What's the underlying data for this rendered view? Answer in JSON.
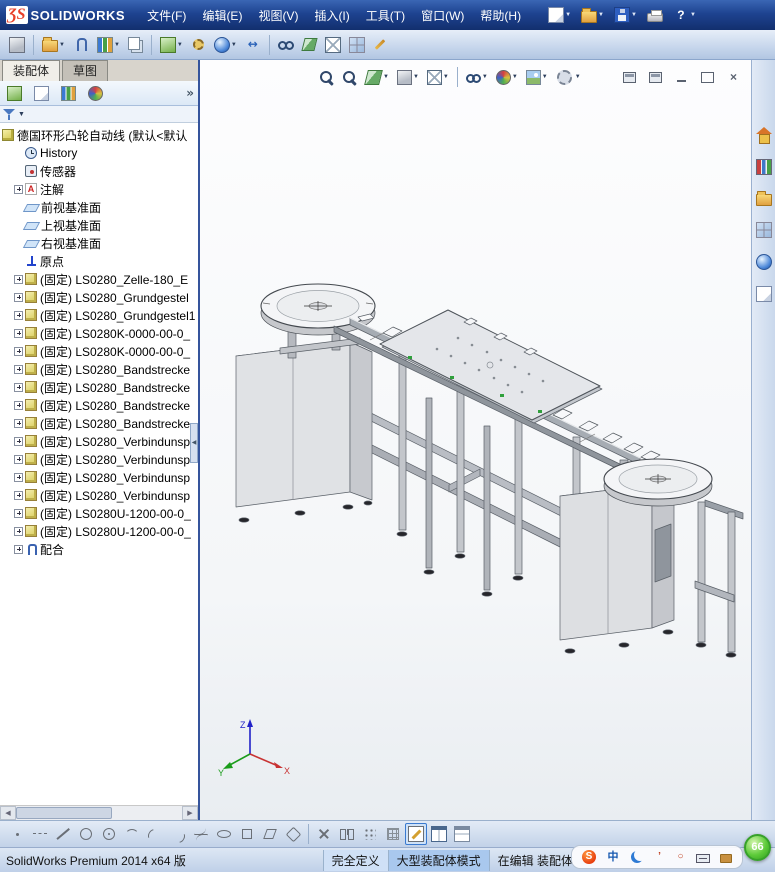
{
  "titlebar": {
    "logo": {
      "mark": "ƷS",
      "text": "SOLIDWORKS"
    },
    "menu": [
      {
        "name": "menu-file",
        "label": "文件(F)"
      },
      {
        "name": "menu-edit",
        "label": "编辑(E)"
      },
      {
        "name": "menu-view",
        "label": "视图(V)"
      },
      {
        "name": "menu-insert",
        "label": "插入(I)"
      },
      {
        "name": "menu-tools",
        "label": "工具(T)"
      },
      {
        "name": "menu-window",
        "label": "窗口(W)"
      },
      {
        "name": "menu-help",
        "label": "帮助(H)"
      }
    ],
    "quick_tools": [
      {
        "name": "new-document-icon",
        "kind": "page",
        "dropdown": true
      },
      {
        "name": "open-document-icon",
        "kind": "folder",
        "dropdown": true
      },
      {
        "name": "save-icon",
        "kind": "floppy",
        "dropdown": true
      },
      {
        "name": "print-icon",
        "kind": "printer",
        "dropdown": false
      },
      {
        "name": "help-icon",
        "kind": "help",
        "glyph": "?",
        "dropdown": true
      }
    ]
  },
  "toolbar": {
    "items": [
      {
        "name": "edit-component-icon",
        "kind": "cube-gray"
      },
      {
        "sep": true
      },
      {
        "name": "insert-component-icon",
        "kind": "folder",
        "dropdown": true
      },
      {
        "name": "mate-icon",
        "kind": "clip"
      },
      {
        "name": "component-pattern-icon",
        "kind": "columns",
        "dropdown": true
      },
      {
        "name": "copy-with-mates-icon",
        "kind": "pages"
      },
      {
        "sep": true
      },
      {
        "name": "assembly-features-icon",
        "kind": "cube-green",
        "dropdown": true
      },
      {
        "name": "smart-fasteners-icon",
        "kind": "gearpair"
      },
      {
        "name": "reference-geometry-icon",
        "kind": "orb-blue",
        "dropdown": true
      },
      {
        "name": "move-component-icon",
        "kind": "arrows",
        "glyph": "↔"
      },
      {
        "sep": true
      },
      {
        "name": "show-hidden-components-icon",
        "kind": "glasses"
      },
      {
        "name": "assembly-visualization-icon",
        "kind": "section"
      },
      {
        "name": "exploded-view-icon",
        "kind": "cube-wire"
      },
      {
        "name": "bill-of-materials-icon",
        "kind": "palette"
      },
      {
        "name": "instant3d-icon",
        "kind": "pencil"
      }
    ]
  },
  "left_panel": {
    "tabs": [
      {
        "name": "tab-assembly",
        "label": "装配体",
        "active": true
      },
      {
        "name": "tab-sketch",
        "label": "草图",
        "active": false
      }
    ],
    "manager_tabs": [
      {
        "name": "featuremanager-tab-icon",
        "kind": "cube-green"
      },
      {
        "name": "propertymanager-tab-icon",
        "kind": "page"
      },
      {
        "name": "configurationmanager-tab-icon",
        "kind": "columns"
      },
      {
        "name": "dimxpertmanager-tab-icon",
        "kind": "orb-rgb"
      }
    ],
    "expand_label": "»",
    "tree": [
      {
        "name": "tree-item-root",
        "icon": "assembly",
        "label": "德国环形凸轮自动线 (默认<默认",
        "indent": 0
      },
      {
        "name": "tree-item-history",
        "icon": "history",
        "label": "History",
        "indent": 1
      },
      {
        "name": "tree-item-sensors",
        "icon": "sensor",
        "label": "传感器",
        "indent": 1
      },
      {
        "name": "tree-item-annotations",
        "icon": "annotation",
        "label": "注解",
        "indent": 1,
        "expander": true
      },
      {
        "name": "tree-item-front-plane",
        "icon": "plane",
        "label": "前视基准面",
        "indent": 1
      },
      {
        "name": "tree-item-top-plane",
        "icon": "plane",
        "label": "上视基准面",
        "indent": 1
      },
      {
        "name": "tree-item-right-plane",
        "icon": "plane",
        "label": "右视基准面",
        "indent": 1
      },
      {
        "name": "tree-item-origin",
        "icon": "origin",
        "label": "原点",
        "indent": 1
      },
      {
        "name": "tree-item-component",
        "icon": "component",
        "label": "(固定) LS0280_Zelle-180_E",
        "indent": 1,
        "expander": true
      },
      {
        "name": "tree-item-component",
        "icon": "component",
        "label": "(固定) LS0280_Grundgestel",
        "indent": 1,
        "expander": true
      },
      {
        "name": "tree-item-component",
        "icon": "component",
        "label": "(固定) LS0280_Grundgestel1",
        "indent": 1,
        "expander": true
      },
      {
        "name": "tree-item-component",
        "icon": "component",
        "label": "(固定) LS0280K-0000-00-0_",
        "indent": 1,
        "expander": true
      },
      {
        "name": "tree-item-component",
        "icon": "component",
        "label": "(固定) LS0280K-0000-00-0_",
        "indent": 1,
        "expander": true
      },
      {
        "name": "tree-item-component",
        "icon": "component",
        "label": "(固定) LS0280_Bandstrecke",
        "indent": 1,
        "expander": true
      },
      {
        "name": "tree-item-component",
        "icon": "component",
        "label": "(固定) LS0280_Bandstrecke",
        "indent": 1,
        "expander": true
      },
      {
        "name": "tree-item-component",
        "icon": "component",
        "label": "(固定) LS0280_Bandstrecke",
        "indent": 1,
        "expander": true
      },
      {
        "name": "tree-item-component",
        "icon": "component",
        "label": "(固定) LS0280_Bandstrecke",
        "indent": 1,
        "expander": true
      },
      {
        "name": "tree-item-component",
        "icon": "component",
        "label": "(固定) LS0280_Verbindunsp",
        "indent": 1,
        "expander": true
      },
      {
        "name": "tree-item-component",
        "icon": "component",
        "label": "(固定) LS0280_Verbindunsp",
        "indent": 1,
        "expander": true
      },
      {
        "name": "tree-item-component",
        "icon": "component",
        "label": "(固定) LS0280_Verbindunsp",
        "indent": 1,
        "expander": true
      },
      {
        "name": "tree-item-component",
        "icon": "component",
        "label": "(固定) LS0280_Verbindunsp",
        "indent": 1,
        "expander": true
      },
      {
        "name": "tree-item-component",
        "icon": "component",
        "label": "(固定) LS0280U-1200-00-0_",
        "indent": 1,
        "expander": true
      },
      {
        "name": "tree-item-component",
        "icon": "component",
        "label": "(固定) LS0280U-1200-00-0_",
        "indent": 1,
        "expander": true
      },
      {
        "name": "tree-item-mates",
        "icon": "mates",
        "label": "配合",
        "indent": 1,
        "expander": true
      }
    ]
  },
  "viewport": {
    "headsup": [
      {
        "name": "zoom-fit-icon",
        "kind": "mag"
      },
      {
        "name": "zoom-area-icon",
        "kind": "mag"
      },
      {
        "name": "section-view-icon",
        "kind": "section",
        "dropdown": true
      },
      {
        "name": "view-orientation-icon",
        "kind": "cube-gray",
        "dropdown": true
      },
      {
        "name": "display-style-icon",
        "kind": "cube-wire",
        "dropdown": true
      },
      {
        "sep": true
      },
      {
        "name": "hide-show-items-icon",
        "kind": "glasses",
        "dropdown": true
      },
      {
        "name": "edit-appearance-icon",
        "kind": "orb-rgb",
        "dropdown": true
      },
      {
        "name": "apply-scene-icon",
        "kind": "scene",
        "dropdown": true
      },
      {
        "name": "view-settings-icon",
        "kind": "settings",
        "dropdown": true
      }
    ],
    "window_controls": [
      {
        "name": "doc-restore-icon",
        "kind": "winpane"
      },
      {
        "name": "doc-tile-icon",
        "kind": "winpane"
      },
      {
        "name": "doc-minimize-icon",
        "kind": "winmin"
      },
      {
        "name": "doc-maximize-icon",
        "kind": "winmax"
      },
      {
        "name": "doc-close-icon",
        "kind": "winclose",
        "glyph": "×"
      }
    ],
    "triad": {
      "x": "X",
      "y": "Y",
      "z": "Z"
    }
  },
  "task_pane": {
    "items": [
      {
        "name": "solidworks-resources-icon",
        "kind": "house"
      },
      {
        "name": "design-library-icon",
        "kind": "books"
      },
      {
        "name": "file-explorer-icon",
        "kind": "folder"
      },
      {
        "name": "view-palette-icon",
        "kind": "palette"
      },
      {
        "name": "appearances-scenes-icon",
        "kind": "orb-blue"
      },
      {
        "name": "custom-properties-icon",
        "kind": "page"
      }
    ]
  },
  "sketch_toolbar": {
    "items": [
      {
        "name": "sketch-point-icon",
        "kind": "sk-point"
      },
      {
        "name": "sketch-centerline-icon",
        "kind": "sk-cline"
      },
      {
        "name": "sketch-line-icon",
        "kind": "sk-line"
      },
      {
        "name": "sketch-circle-icon",
        "kind": "sk-circle"
      },
      {
        "name": "sketch-perimeter-circle-icon",
        "kind": "sk-circ2"
      },
      {
        "name": "sketch-arc-icon",
        "kind": "sk-arc"
      },
      {
        "name": "sketch-3point-arc-icon",
        "kind": "sk-arc2"
      },
      {
        "name": "sketch-tangent-arc-icon",
        "kind": "sk-arc3"
      },
      {
        "name": "sketch-spline-icon",
        "kind": "sk-spline"
      },
      {
        "name": "sketch-ellipse-icon",
        "kind": "sk-ellipse"
      },
      {
        "name": "sketch-rectangle-icon",
        "kind": "sk-rect"
      },
      {
        "name": "sketch-parallelogram-icon",
        "kind": "sk-para"
      },
      {
        "name": "sketch-polygon-icon",
        "kind": "sk-poly"
      },
      {
        "sep": true
      },
      {
        "name": "sketch-trim-icon",
        "kind": "sk-trim"
      },
      {
        "name": "sketch-mirror-icon",
        "kind": "sk-mirror"
      },
      {
        "name": "sketch-pattern-icon",
        "kind": "sk-pattern"
      },
      {
        "name": "grid-snap-icon",
        "kind": "sk-grid"
      },
      {
        "name": "sketch-icon",
        "kind": "sk-sketch",
        "active": true
      },
      {
        "name": "rapid-sketch-icon",
        "kind": "sk-table"
      },
      {
        "name": "3d-sketch-icon",
        "kind": "sk-table2"
      }
    ]
  },
  "statusbar": {
    "left": "SolidWorks Premium 2014 x64 版",
    "segments": [
      {
        "name": "status-definition",
        "label": "完全定义",
        "hl": 1
      },
      {
        "name": "status-assembly-mode",
        "label": "大型装配体模式",
        "hl": 2
      },
      {
        "name": "status-editing",
        "label": "在编辑 装配体",
        "hl": 0
      }
    ]
  },
  "tray": {
    "ball": "66",
    "icons": [
      {
        "name": "sogou-logo-icon",
        "kind": "sogou",
        "glyph": "S"
      },
      {
        "name": "ime-cn-icon",
        "kind": "imetxt",
        "glyph": "中"
      },
      {
        "name": "ime-moon-icon",
        "kind": "moon"
      },
      {
        "name": "ime-punct-icon",
        "kind": "imetxt2",
        "glyph": "’"
      },
      {
        "name": "ime-width-icon",
        "kind": "imetxt2",
        "glyph": "○"
      },
      {
        "name": "ime-keyboard-icon",
        "kind": "keyb"
      },
      {
        "name": "ime-toolbox-icon",
        "kind": "toolbox"
      }
    ]
  }
}
